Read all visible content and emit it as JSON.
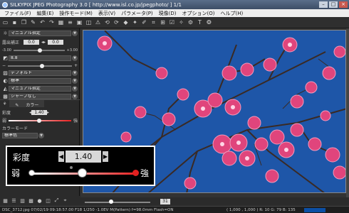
{
  "window": {
    "title": "SILKYPIX JPEG Photography 3.0 [ http://www.isl.co.jp/jpegphoto/ ]  1/1"
  },
  "menu": [
    "ファイル(F)",
    "編集(E)",
    "操作モード(M)",
    "表示(V)",
    "パラメータ(P)",
    "現像(D)",
    "オプション(O)",
    "ヘルプ(H)"
  ],
  "panel": {
    "white_balance": "マニュアル指定",
    "exposure_label": "露出補正",
    "exposure_value_1": "0.0",
    "exposure_value_2": "0.0",
    "exposure_min": "-3.00",
    "exposure_max": "+3.00",
    "tone_value": "8.8",
    "contrast_value": "デフォルト",
    "color_value": "標準",
    "sharp_value": "マニュアル指定",
    "nr_value": "シャープなし",
    "tab_color": "カラー",
    "saturation_label": "彩度",
    "saturation_value": "1.40",
    "weak_label": "弱",
    "strong_label": "強",
    "color_mode_label": "カラーモード",
    "color_mode_value": "標準色"
  },
  "popup": {
    "label": "彩度",
    "value": "1.40",
    "weak": "弱",
    "strong": "強",
    "slider_level": 0.47
  },
  "zoom": {
    "value": "31"
  },
  "status": {
    "info": "DSC_3712.jpg  07/02/19 09:18:57.00 F18 1/250 -1.0EV M(Pattern) f=98.0mm Flash=ON",
    "rgb": "( 1,000 , 1,000 )    R: 10  G: 79  B: 135"
  },
  "colors": {
    "sky": "#1e56a8",
    "blossom": "#e0457c",
    "accent_red": "#e22020",
    "pixel_swatch": "#0b4fa5"
  }
}
